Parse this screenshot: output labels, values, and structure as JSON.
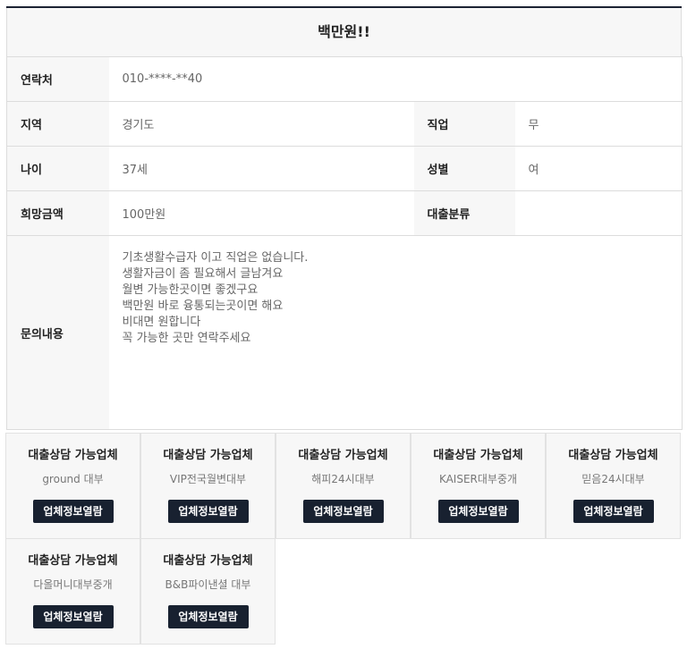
{
  "post": {
    "title": "백만원!!",
    "fields": {
      "contact": {
        "label": "연락처",
        "value": "010-****-**40"
      },
      "region": {
        "label": "지역",
        "value": "경기도"
      },
      "job": {
        "label": "직업",
        "value": "무"
      },
      "age": {
        "label": "나이",
        "value": "37세"
      },
      "gender": {
        "label": "성별",
        "value": "여"
      },
      "amount": {
        "label": "희망금액",
        "value": "100만원"
      },
      "loan_type": {
        "label": "대출분류",
        "value": ""
      },
      "inquiry": {
        "label": "문의내용",
        "lines": [
          "기초생활수급자 이고 직업은 없습니다.",
          "생활자금이 좀 필요해서 글남겨요",
          "월변 가능한곳이면 좋겠구요",
          "백만원 바로 융통되는곳이면 해요",
          "비대면 원합니다",
          "꼭 가능한 곳만 연락주세요"
        ]
      }
    }
  },
  "companies": {
    "heading": "대출상담 가능업체",
    "button_label": "업체정보열람",
    "items": [
      {
        "name": "ground 대부"
      },
      {
        "name": "VIP전국월변대부"
      },
      {
        "name": "해피24시대부"
      },
      {
        "name": "KAISER대부중개"
      },
      {
        "name": "믿음24시대부"
      },
      {
        "name": "다올머니대부중개"
      },
      {
        "name": "B&B파이낸셜 대부"
      }
    ]
  }
}
